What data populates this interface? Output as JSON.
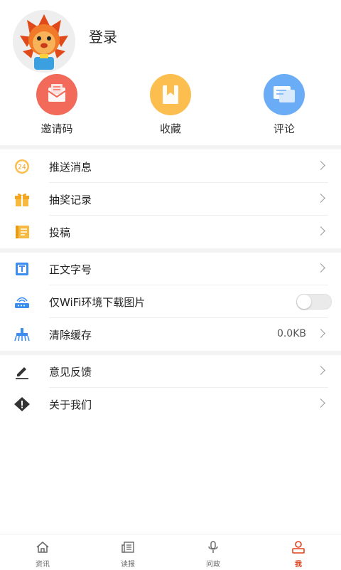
{
  "profile": {
    "login_label": "登录"
  },
  "quick_actions": [
    {
      "label": "邀请码",
      "icon": "invite-envelope-icon",
      "color": "#f26a5a"
    },
    {
      "label": "收藏",
      "icon": "bookmark-icon",
      "color": "#fbbe4f"
    },
    {
      "label": "评论",
      "icon": "comment-icon",
      "color": "#6aacf5"
    }
  ],
  "menu_group1": [
    {
      "label": "推送消息",
      "icon": "push-24-icon"
    },
    {
      "label": "抽奖记录",
      "icon": "gift-icon"
    },
    {
      "label": "投稿",
      "icon": "notebook-icon"
    }
  ],
  "menu_group2": [
    {
      "label": "正文字号",
      "icon": "font-size-icon"
    },
    {
      "label": "仅WiFi环境下载图片",
      "icon": "wifi-router-icon",
      "toggle": false
    },
    {
      "label": "清除缓存",
      "icon": "broom-icon",
      "value": "0.0KB"
    }
  ],
  "menu_group3": [
    {
      "label": "意见反馈",
      "icon": "pen-icon"
    },
    {
      "label": "关于我们",
      "icon": "info-diamond-icon"
    }
  ],
  "tabs": [
    {
      "label": "资讯",
      "icon": "home-icon"
    },
    {
      "label": "读报",
      "icon": "newspaper-icon"
    },
    {
      "label": "问政",
      "icon": "microphone-icon"
    },
    {
      "label": "我",
      "icon": "user-icon",
      "active": true
    }
  ],
  "colors": {
    "accent": "#e2401c",
    "divider": "#f3f3f3"
  }
}
